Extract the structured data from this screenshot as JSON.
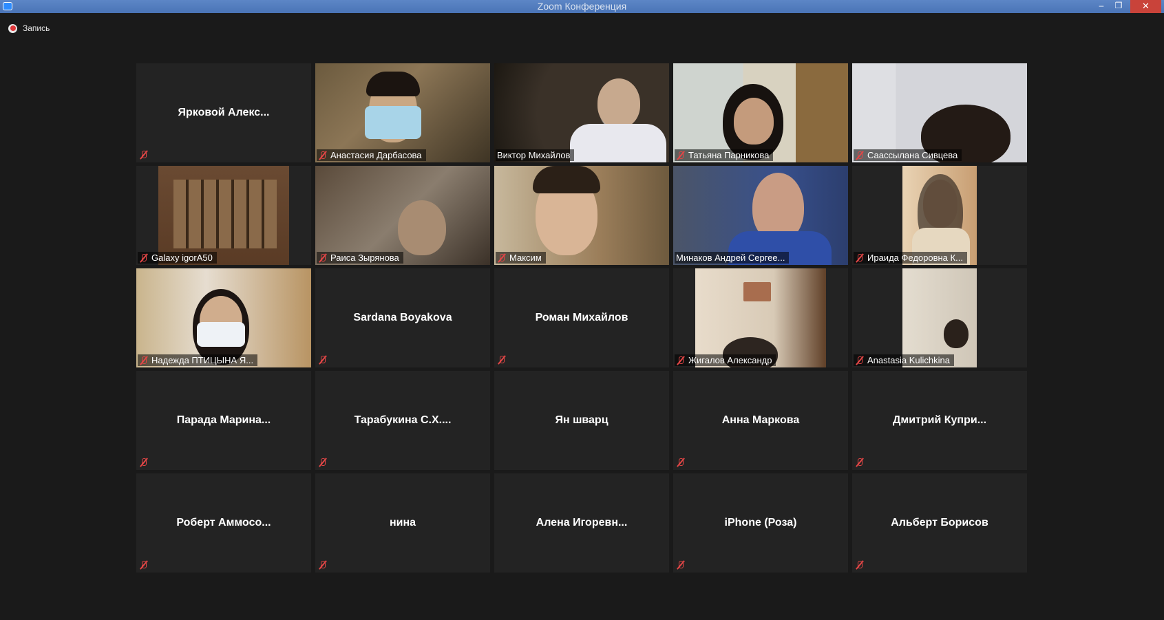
{
  "window": {
    "title": "Zoom Конференция",
    "minimize": "–",
    "maximize": "❐",
    "close": "✕"
  },
  "recording": {
    "label": "Запись"
  },
  "participants": [
    {
      "name": "Ярковой Алекс...",
      "video": false,
      "muted": true
    },
    {
      "name": "Анастасия Дарбасова",
      "video": true,
      "muted": true
    },
    {
      "name": "Виктор Михайлов",
      "video": true,
      "muted": false
    },
    {
      "name": "Татьяна Парникова",
      "video": true,
      "muted": true
    },
    {
      "name": "Саассылана Сивцева",
      "video": true,
      "muted": true
    },
    {
      "name": "Galaxy igorA50",
      "video": true,
      "muted": true
    },
    {
      "name": "Раиса Зырянова",
      "video": true,
      "muted": true
    },
    {
      "name": "Максим",
      "video": true,
      "muted": true
    },
    {
      "name": "Минаков Андрей Сергее...",
      "video": true,
      "muted": false,
      "active_speaker": true
    },
    {
      "name": "Ираида Федоровна К...",
      "video": true,
      "muted": true
    },
    {
      "name": "Надежда ПТИЦЫНА Я...",
      "video": true,
      "muted": true
    },
    {
      "name": "Sardana Boyakova",
      "video": false,
      "muted": true
    },
    {
      "name": "Роман Михайлов",
      "video": false,
      "muted": true
    },
    {
      "name": "Жигалов Александр",
      "video": true,
      "muted": true
    },
    {
      "name": "Anastasia Kulichkina",
      "video": true,
      "muted": true
    },
    {
      "name": "Парада Марина...",
      "video": false,
      "muted": true
    },
    {
      "name": "Тарабукина С.Х....",
      "video": false,
      "muted": true
    },
    {
      "name": "Ян шварц",
      "video": false,
      "muted": false
    },
    {
      "name": "Анна Маркова",
      "video": false,
      "muted": true
    },
    {
      "name": "Дмитрий Купри...",
      "video": false,
      "muted": true
    },
    {
      "name": "Роберт Аммосо...",
      "video": false,
      "muted": true
    },
    {
      "name": "нина",
      "video": false,
      "muted": true
    },
    {
      "name": "Алена Игоревн...",
      "video": false,
      "muted": false
    },
    {
      "name": "iPhone (Роза)",
      "video": false,
      "muted": true
    },
    {
      "name": "Альберт Борисов",
      "video": false,
      "muted": true
    }
  ],
  "colors": {
    "background": "#1a1a1a",
    "tile": "#232323",
    "active_speaker_border": "#c8d84a",
    "muted_icon": "#e34646",
    "titlebar": "#4a74b6"
  }
}
